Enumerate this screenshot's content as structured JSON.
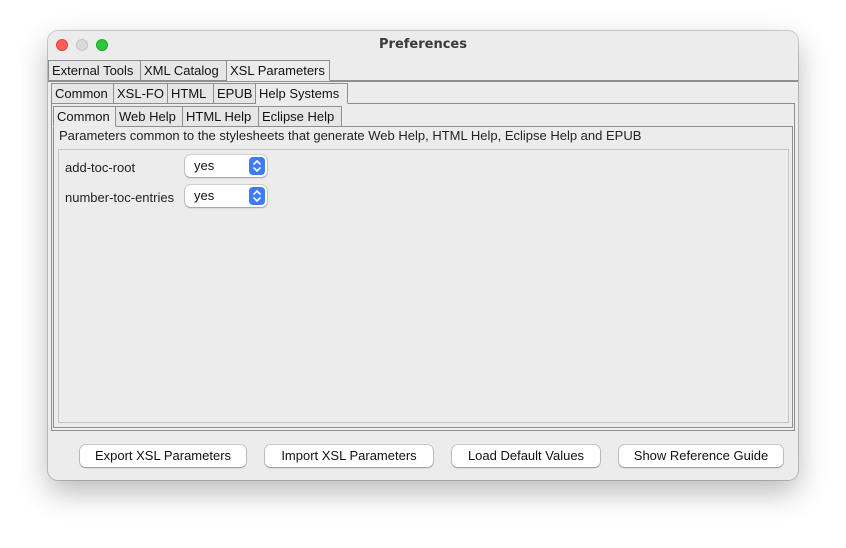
{
  "window": {
    "title": "Preferences"
  },
  "tabs_level1": [
    "External Tools",
    "XML Catalog",
    "XSL Parameters"
  ],
  "tabs_level2": [
    "Common",
    "XSL-FO",
    "HTML",
    "EPUB",
    "Help Systems"
  ],
  "tabs_level3": [
    "Common",
    "Web Help",
    "HTML Help",
    "Eclipse Help"
  ],
  "description": "Parameters common to the stylesheets that generate Web Help, HTML Help, Eclipse Help and EPUB",
  "params": [
    {
      "name": "add-toc-root",
      "value": "yes"
    },
    {
      "name": "number-toc-entries",
      "value": "yes"
    }
  ],
  "buttons": {
    "export": "Export XSL Parameters",
    "import": "Import XSL Parameters",
    "load_defaults": "Load Default Values",
    "reference": "Show Reference Guide"
  },
  "colors": {
    "close": "#fe5f57",
    "minimize": "#d9d9d9",
    "zoom": "#2ac840",
    "accent": "#3e7bf7"
  }
}
